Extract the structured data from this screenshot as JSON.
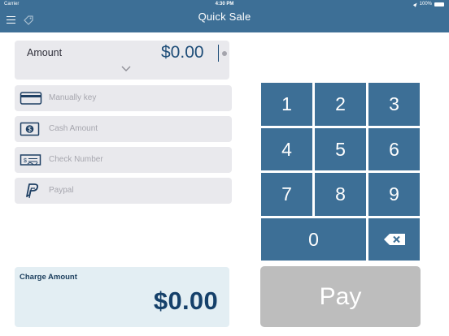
{
  "status_bar": {
    "carrier": "Carrier",
    "time": "4:30 PM",
    "battery": "100%"
  },
  "nav": {
    "title": "Quick Sale",
    "menu_icon": "hamburger-menu-icon",
    "tag_icon": "tag-icon"
  },
  "amount": {
    "label": "Amount",
    "value": "$0.00"
  },
  "payment_methods": [
    {
      "label": "Manually key",
      "icon": "credit-card-icon"
    },
    {
      "label": "Cash Amount",
      "icon": "cash-icon"
    },
    {
      "label": "Check Number",
      "icon": "check-icon"
    },
    {
      "label": "Paypal",
      "icon": "paypal-icon"
    }
  ],
  "charge": {
    "label": "Charge Amount",
    "value": "$0.00"
  },
  "keypad": {
    "keys": [
      "1",
      "2",
      "3",
      "4",
      "5",
      "6",
      "7",
      "8",
      "9",
      "0"
    ],
    "backspace_icon": "backspace-icon"
  },
  "pay_button": {
    "label": "Pay"
  },
  "colors": {
    "brand": "#3d6f96",
    "charge_bg": "#e3eef3",
    "pay_disabled": "#bdbdbd",
    "field_bg": "#e9e9ed"
  }
}
